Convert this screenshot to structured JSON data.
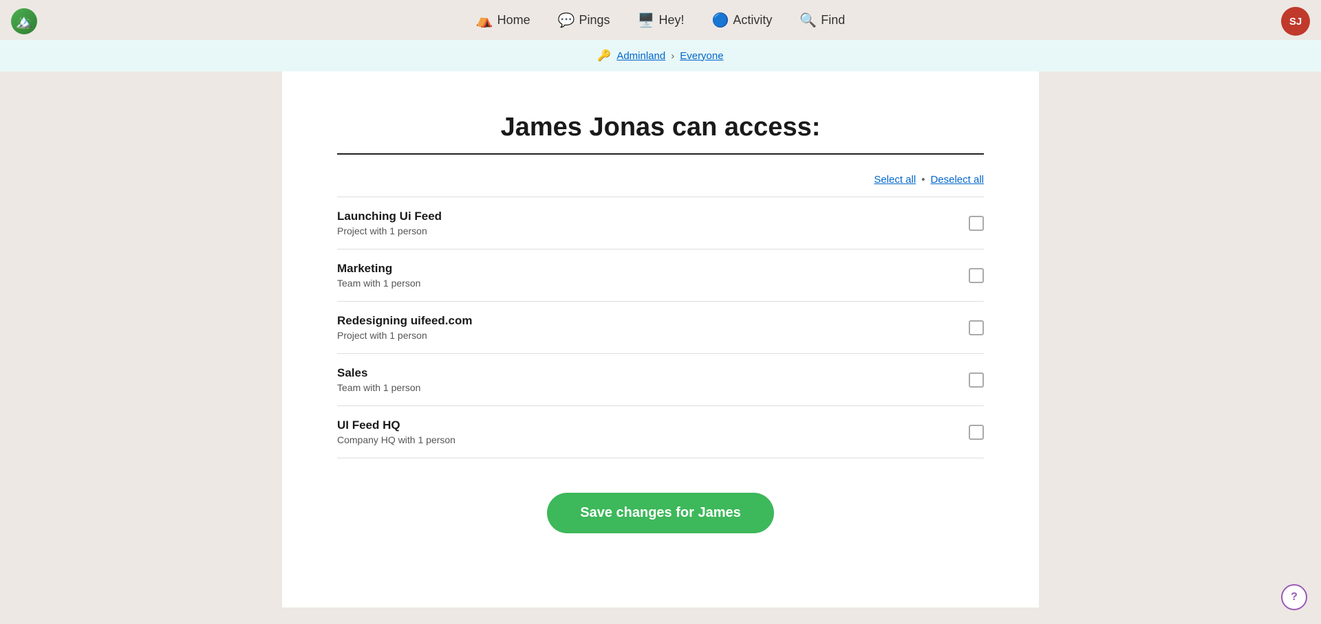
{
  "logo": {
    "emoji": "🏔️",
    "alt": "Basecamp logo"
  },
  "user_avatar": {
    "initials": "SJ",
    "bg_color": "#c0392b"
  },
  "nav": {
    "items": [
      {
        "label": "Home",
        "icon": "⛺"
      },
      {
        "label": "Pings",
        "icon": "💬"
      },
      {
        "label": "Hey!",
        "icon": "🖥️"
      },
      {
        "label": "Activity",
        "icon": "🔵"
      },
      {
        "label": "Find",
        "icon": "🔍"
      }
    ]
  },
  "breadcrumb": {
    "icon": "🔑",
    "adminland_label": "Adminland",
    "separator": "›",
    "current_label": "Everyone"
  },
  "page": {
    "title": "James Jonas can access:",
    "select_all": "Select all",
    "deselect_all": "Deselect all",
    "dot_separator": "•"
  },
  "access_items": [
    {
      "name": "Launching Ui Feed",
      "description": "Project with 1 person",
      "checked": false
    },
    {
      "name": "Marketing",
      "description": "Team with 1 person",
      "checked": false
    },
    {
      "name": "Redesigning uifeed.com",
      "description": "Project with 1 person",
      "checked": false
    },
    {
      "name": "Sales",
      "description": "Team with 1 person",
      "checked": false
    },
    {
      "name": "UI Feed HQ",
      "description": "Company HQ with 1 person",
      "checked": false
    }
  ],
  "save_button": {
    "label": "Save changes for James"
  },
  "help_button": {
    "label": "?"
  }
}
